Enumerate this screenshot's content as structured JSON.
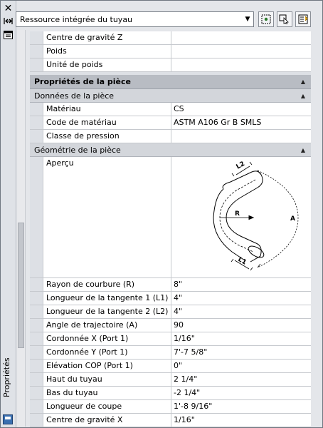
{
  "palette": {
    "title": "Propriétés",
    "icons": {
      "close": "close-icon",
      "autohide": "autohide-icon",
      "properties": "properties-icon"
    }
  },
  "toolbar": {
    "selected_object": "Ressource intégrée du tuyau",
    "buttons": [
      "quick-select-icon",
      "select-objects-icon",
      "pickadd-icon"
    ]
  },
  "rows_top": [
    {
      "label": "Centre de gravité Z",
      "value": ""
    },
    {
      "label": "Poids",
      "value": ""
    },
    {
      "label": "Unité de poids",
      "value": ""
    }
  ],
  "category": {
    "title": "Propriétés de la pièce"
  },
  "part_data": {
    "title": "Données de la pièce",
    "rows": [
      {
        "label": "Matériau",
        "value": "CS"
      },
      {
        "label": "Code de matériau",
        "value": "ASTM A106 Gr B SMLS"
      },
      {
        "label": "Classe de pression",
        "value": ""
      }
    ]
  },
  "geometry": {
    "title": "Géométrie de la pièce",
    "preview_label": "Aperçu",
    "diagram_labels": {
      "l2": "L2",
      "l1": "L1",
      "r": "R",
      "a": "A"
    },
    "rows": [
      {
        "label": "Rayon de courbure (R)",
        "value": "8\""
      },
      {
        "label": "Longueur de la tangente 1 (L1)",
        "value": "4\""
      },
      {
        "label": "Longueur de la tangente 2 (L2)",
        "value": "4\""
      },
      {
        "label": "Angle de trajectoire (A)",
        "value": "90"
      },
      {
        "label": "Cordonnée X (Port 1)",
        "value": "1/16\""
      },
      {
        "label": "Cordonnée Y (Port 1)",
        "value": "7'-7 5/8\""
      },
      {
        "label": "Elévation COP (Port 1)",
        "value": "0\""
      },
      {
        "label": "Haut du tuyau",
        "value": "2 1/4\""
      },
      {
        "label": "Bas du tuyau",
        "value": "-2 1/4\""
      },
      {
        "label": "Longueur de coupe",
        "value": "1'-8 9/16\""
      },
      {
        "label": "Centre de gravité X",
        "value": "1/16\""
      }
    ]
  }
}
